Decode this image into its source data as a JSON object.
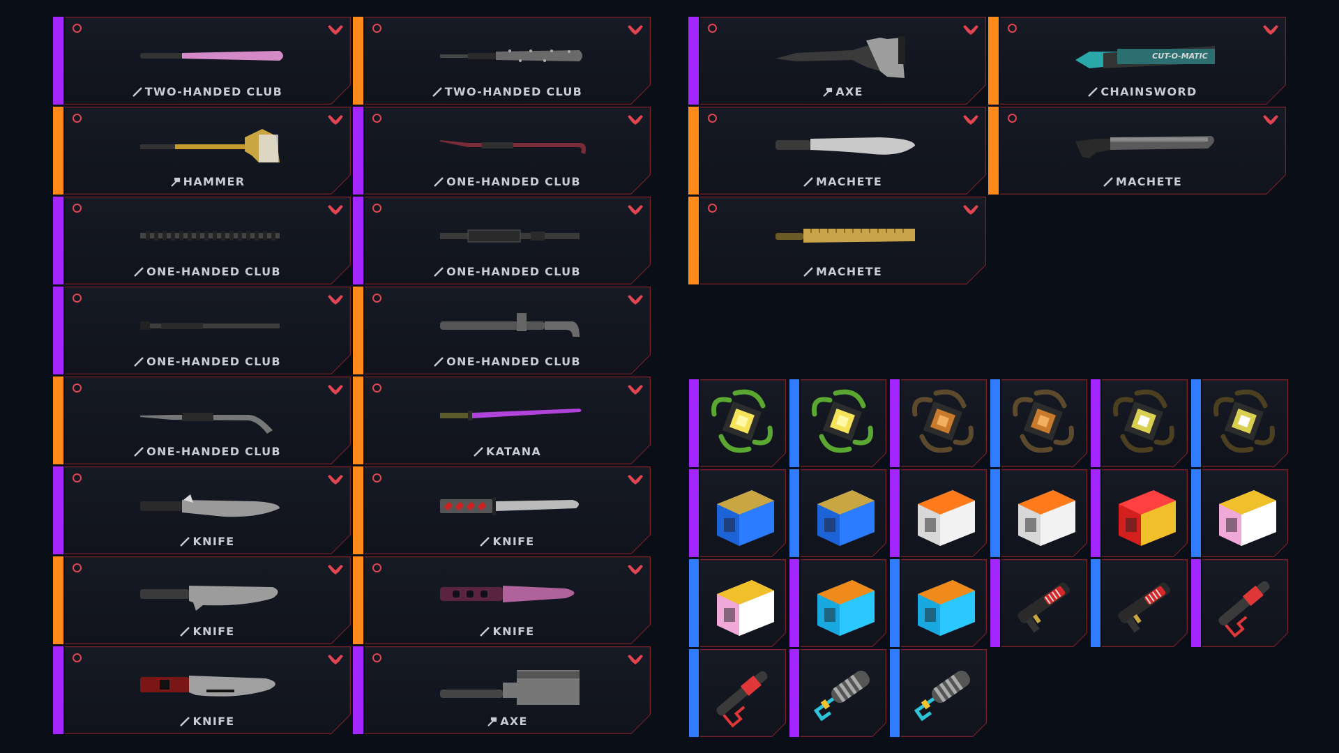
{
  "colors": {
    "purple": "#a426ff",
    "orange": "#ff8a1a",
    "blue": "#2f7cff",
    "accent_red": "#e14551",
    "background": "#0a0e17",
    "label_text": "#c8ccd4"
  },
  "weapons": [
    {
      "label": "TWO-HANDED CLUB",
      "rarity": "purple",
      "type_icon": "blade-icon",
      "art": "pink-bat"
    },
    {
      "label": "TWO-HANDED CLUB",
      "rarity": "orange",
      "type_icon": "blade-icon",
      "art": "spiked-bat"
    },
    {
      "label": "HAMMER",
      "rarity": "orange",
      "type_icon": "hammer-icon",
      "art": "hammer"
    },
    {
      "label": "ONE-HANDED CLUB",
      "rarity": "purple",
      "type_icon": "blade-icon",
      "art": "crowbar"
    },
    {
      "label": "ONE-HANDED CLUB",
      "rarity": "purple",
      "type_icon": "blade-icon",
      "art": "chain-baton"
    },
    {
      "label": "ONE-HANDED CLUB",
      "rarity": "purple",
      "type_icon": "blade-icon",
      "art": "pipe-baton"
    },
    {
      "label": "ONE-HANDED CLUB",
      "rarity": "purple",
      "type_icon": "blade-icon",
      "art": "steel-rod"
    },
    {
      "label": "ONE-HANDED CLUB",
      "rarity": "orange",
      "type_icon": "blade-icon",
      "art": "pipe-wrench"
    },
    {
      "label": "ONE-HANDED CLUB",
      "rarity": "orange",
      "type_icon": "blade-icon",
      "art": "tire-iron"
    },
    {
      "label": "KATANA",
      "rarity": "orange",
      "type_icon": "blade-icon",
      "art": "katana"
    },
    {
      "label": "KNIFE",
      "rarity": "purple",
      "type_icon": "blade-icon",
      "art": "kitchen-knife"
    },
    {
      "label": "KNIFE",
      "rarity": "orange",
      "type_icon": "blade-icon",
      "art": "tanto-knife"
    },
    {
      "label": "KNIFE",
      "rarity": "orange",
      "type_icon": "blade-icon",
      "art": "combat-knife"
    },
    {
      "label": "KNIFE",
      "rarity": "orange",
      "type_icon": "blade-icon",
      "art": "pink-knife"
    },
    {
      "label": "KNIFE",
      "rarity": "purple",
      "type_icon": "blade-icon",
      "art": "red-knife"
    },
    {
      "label": "AXE",
      "rarity": "purple",
      "type_icon": "hammer-icon",
      "art": "cleaver-axe"
    },
    {
      "label": "AXE",
      "rarity": "purple",
      "type_icon": "hammer-icon",
      "art": "tactical-axe"
    },
    {
      "label": "CHAINSWORD",
      "rarity": "orange",
      "type_icon": "blade-icon",
      "art": "chainsword",
      "art_text": "CUT-O-MATIC"
    },
    {
      "label": "MACHETE",
      "rarity": "orange",
      "type_icon": "blade-icon",
      "art": "kukri"
    },
    {
      "label": "MACHETE",
      "rarity": "orange",
      "type_icon": "blade-icon",
      "art": "dark-machete"
    },
    {
      "label": "MACHETE",
      "rarity": "orange",
      "type_icon": "blade-icon",
      "art": "gold-machete"
    }
  ],
  "mods": [
    {
      "rarity": "purple",
      "art": "cyberware-chip-green"
    },
    {
      "rarity": "blue",
      "art": "cyberware-chip-green"
    },
    {
      "rarity": "purple",
      "art": "cyberware-chip-orange"
    },
    {
      "rarity": "blue",
      "art": "cyberware-chip-orange"
    },
    {
      "rarity": "purple",
      "art": "cyberware-chip-dark"
    },
    {
      "rarity": "blue",
      "art": "cyberware-chip-dark"
    },
    {
      "rarity": "purple",
      "art": "blue-module"
    },
    {
      "rarity": "blue",
      "art": "blue-module"
    },
    {
      "rarity": "purple",
      "art": "white-module"
    },
    {
      "rarity": "blue",
      "art": "white-module"
    },
    {
      "rarity": "purple",
      "art": "red-box"
    },
    {
      "rarity": "blue",
      "art": "pink-box"
    },
    {
      "rarity": "blue",
      "art": "pink-box"
    },
    {
      "rarity": "purple",
      "art": "cyan-box"
    },
    {
      "rarity": "blue",
      "art": "cyan-box"
    },
    {
      "rarity": "purple",
      "art": "red-injector"
    },
    {
      "rarity": "blue",
      "art": "red-injector"
    },
    {
      "rarity": "purple",
      "art": "red-launcher"
    },
    {
      "rarity": "blue",
      "art": "red-launcher"
    },
    {
      "rarity": "purple",
      "art": "cyan-cylinder"
    },
    {
      "rarity": "blue",
      "art": "cyan-cylinder"
    }
  ]
}
